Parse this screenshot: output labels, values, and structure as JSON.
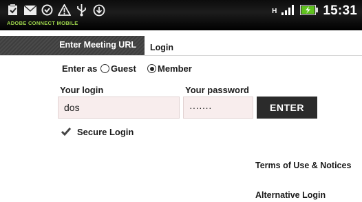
{
  "status_bar": {
    "time": "15:31",
    "brand": "ADOBE CONNECT MOBILE",
    "network_label": "H",
    "icons": [
      "clipboard-icon",
      "mail-icon",
      "sync-icon",
      "warning-icon",
      "usb-icon",
      "download-icon",
      "signal-icon",
      "battery-charging-icon"
    ]
  },
  "tabs": {
    "meeting_url": "Enter Meeting URL",
    "login": "Login"
  },
  "form": {
    "enter_as": "Enter as",
    "guest": "Guest",
    "member": "Member",
    "selected_role": "Member",
    "login_label": "Your login",
    "login_value": "dos",
    "password_label": "Your password",
    "password_value": "·······",
    "enter_button": "ENTER",
    "secure_login": "Secure Login",
    "secure_checked": true
  },
  "links": {
    "terms": "Terms of Use & Notices",
    "alternative": "Alternative Login"
  },
  "colors": {
    "status_bar": "#000000",
    "brand_green": "#9bd14a",
    "field_bg": "#f8eded",
    "button_bg": "#2b2b2b"
  }
}
